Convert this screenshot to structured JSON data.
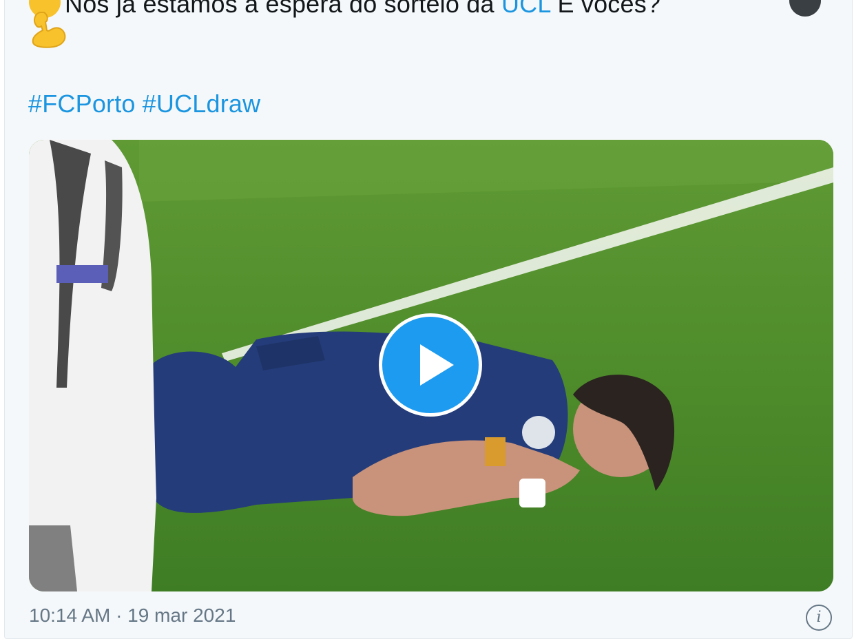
{
  "tweet": {
    "text_visible": "Nós já estamos à espera do sorteio da",
    "mention": "UCL",
    "text_after": "E vocês?",
    "hashtags": [
      "#FCPorto",
      "#UCLdraw"
    ],
    "timestamp": "10:14 AM · 19 mar 2021",
    "info_symbol": "i"
  },
  "media": {
    "type": "video",
    "play_button": "play-icon"
  },
  "icons": {
    "emoji_start": "emoji-icon",
    "emoji_end": "eyes-emoji-icon",
    "muscle": "flexed-biceps-emoji-icon",
    "info": "info-icon"
  },
  "colors": {
    "link": "#1b95e0",
    "text": "#14171a",
    "muted": "#657786",
    "play": "#1d9bf0",
    "card_bg": "#f5f8fa"
  }
}
